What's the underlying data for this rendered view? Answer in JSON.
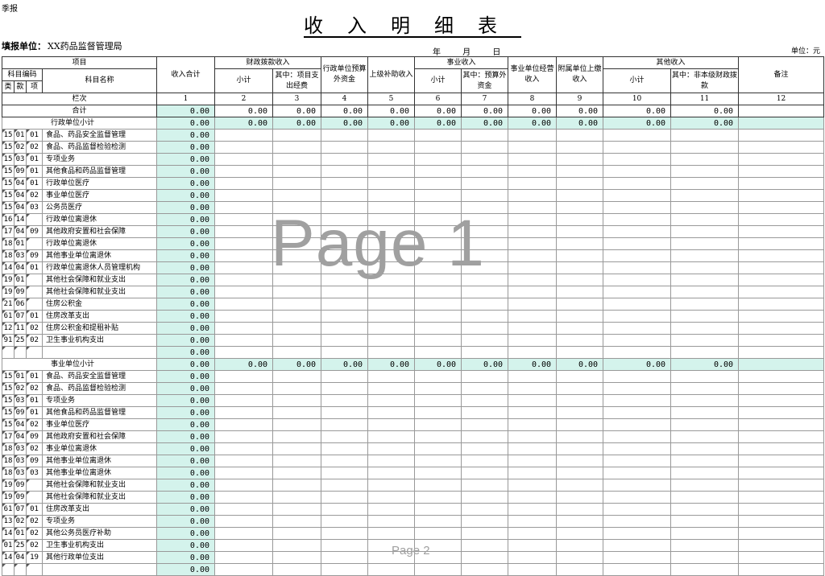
{
  "page": {
    "corner_label": "季报",
    "title": "收入明细表",
    "unit_label": "填报单位：",
    "unit_name": "XX药品监督管理局",
    "date_text": "年 月 日",
    "money_unit": "单位：元",
    "watermark": "Page 1",
    "watermark2": "Page 2"
  },
  "header": {
    "item": "项目",
    "subject_code": "科目编码",
    "subject_name": "科目名称",
    "lei": "类",
    "kuan": "款",
    "xiang": "项",
    "income_total": "收入合计",
    "fiscal": "财政拨款收入",
    "subtotal": "小计",
    "fiscal_sub": "其中：项目支出经费",
    "extra_budget": "行政单位预算外资金",
    "upper_sub": "上级补助收入",
    "business": "事业收入",
    "biz_small": "小计",
    "biz_extra": "其中：预算外资金",
    "biz_oper": "事业单位经营收入",
    "affiliated": "附属单位上缴收入",
    "other": "其他收入",
    "other_small": "小计",
    "other_sub": "其中：非本级财政拨款",
    "remark": "备注",
    "col_label": "栏次",
    "col_nums": [
      "1",
      "2",
      "3",
      "4",
      "5",
      "6",
      "7",
      "8",
      "9",
      "10",
      "11",
      "12"
    ],
    "sum_label": "合计"
  },
  "zero": "0.00",
  "sections": [
    {
      "title": "行政单位小计",
      "rows": [
        {
          "lei": "15",
          "kuan": "01",
          "xiang": "01",
          "name": "食品、药品安全监督管理"
        },
        {
          "lei": "15",
          "kuan": "02",
          "xiang": "02",
          "name": "食品、药品监督检验检测"
        },
        {
          "lei": "15",
          "kuan": "03",
          "xiang": "01",
          "name": "专项业务"
        },
        {
          "lei": "15",
          "kuan": "09",
          "xiang": "01",
          "name": "其他食品和药品监督管理"
        },
        {
          "lei": "15",
          "kuan": "04",
          "xiang": "01",
          "name": "行政单位医疗"
        },
        {
          "lei": "15",
          "kuan": "04",
          "xiang": "02",
          "name": "事业单位医疗"
        },
        {
          "lei": "15",
          "kuan": "04",
          "xiang": "03",
          "name": "公务员医疗"
        },
        {
          "lei": "16",
          "kuan": "14",
          "xiang": "",
          "name": "行政单位离退休"
        },
        {
          "lei": "17",
          "kuan": "04",
          "xiang": "09",
          "name": "其他政府安置和社会保障"
        },
        {
          "lei": "18",
          "kuan": "01",
          "xiang": "",
          "name": "行政单位离退休"
        },
        {
          "lei": "18",
          "kuan": "03",
          "xiang": "09",
          "name": "其他事业单位离退休"
        },
        {
          "lei": "14",
          "kuan": "04",
          "xiang": "01",
          "name": "行政单位离退休人员管理机构"
        },
        {
          "lei": "19",
          "kuan": "01",
          "xiang": "",
          "name": "其他社会保障和就业支出"
        },
        {
          "lei": "19",
          "kuan": "09",
          "xiang": "",
          "name": "其他社会保障和就业支出"
        },
        {
          "lei": "21",
          "kuan": "06",
          "xiang": "",
          "name": "住房公积金"
        },
        {
          "lei": "61",
          "kuan": "07",
          "xiang": "01",
          "name": "住房改革支出"
        },
        {
          "lei": "12",
          "kuan": "11",
          "xiang": "02",
          "name": "住房公积金和提租补贴"
        },
        {
          "lei": "91",
          "kuan": "25",
          "xiang": "02",
          "name": "卫生事业机构支出"
        },
        {
          "lei": "",
          "kuan": "",
          "xiang": "",
          "name": ""
        }
      ]
    },
    {
      "title": "事业单位小计",
      "rows": [
        {
          "lei": "15",
          "kuan": "01",
          "xiang": "01",
          "name": "食品、药品安全监督管理"
        },
        {
          "lei": "15",
          "kuan": "02",
          "xiang": "02",
          "name": "食品、药品监督检验检测"
        },
        {
          "lei": "15",
          "kuan": "03",
          "xiang": "01",
          "name": "专项业务"
        },
        {
          "lei": "15",
          "kuan": "09",
          "xiang": "01",
          "name": "其他食品和药品监督管理"
        },
        {
          "lei": "15",
          "kuan": "04",
          "xiang": "02",
          "name": "事业单位医疗"
        },
        {
          "lei": "17",
          "kuan": "04",
          "xiang": "09",
          "name": "其他政府安置和社会保障"
        },
        {
          "lei": "18",
          "kuan": "03",
          "xiang": "02",
          "name": "事业单位离退休"
        },
        {
          "lei": "18",
          "kuan": "03",
          "xiang": "09",
          "name": "其他事业单位离退休"
        },
        {
          "lei": "18",
          "kuan": "03",
          "xiang": "03",
          "name": "其他事业单位离退休"
        },
        {
          "lei": "19",
          "kuan": "09",
          "xiang": "",
          "name": "其他社会保障和就业支出"
        },
        {
          "lei": "19",
          "kuan": "09",
          "xiang": "",
          "name": "其他社会保障和就业支出"
        },
        {
          "lei": "61",
          "kuan": "07",
          "xiang": "01",
          "name": "住房改革支出"
        },
        {
          "lei": "13",
          "kuan": "02",
          "xiang": "02",
          "name": "专项业务"
        },
        {
          "lei": "14",
          "kuan": "01",
          "xiang": "02",
          "name": "其他公务员医疗补助"
        },
        {
          "lei": "01",
          "kuan": "25",
          "xiang": "02",
          "name": "卫生事业机构支出"
        },
        {
          "lei": "14",
          "kuan": "04",
          "xiang": "19",
          "name": "其他行政单位支出"
        },
        {
          "lei": "",
          "kuan": "",
          "xiang": "",
          "name": ""
        }
      ]
    }
  ]
}
